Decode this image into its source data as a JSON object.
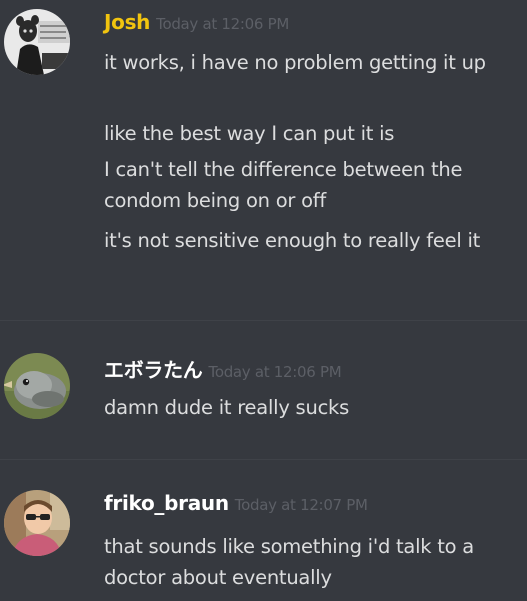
{
  "messages": [
    {
      "author": "Josh",
      "author_color": "#f1c40f",
      "timestamp": "Today at 12:06 PM",
      "lines": [
        "it works, i have no problem getting it up",
        "like the best way I can put it is",
        "I can't tell the difference between the condom being on or off",
        "it's not sensitive enough to really feel it"
      ]
    },
    {
      "author": "エボラたん",
      "author_color": "#ffffff",
      "timestamp": "Today at 12:06 PM",
      "lines": [
        "damn dude it really sucks"
      ]
    },
    {
      "author": "friko_braun",
      "author_color": "#ffffff",
      "timestamp": "Today at 12:07 PM",
      "lines": [
        "that sounds like something i'd talk to a doctor about eventually"
      ]
    }
  ]
}
